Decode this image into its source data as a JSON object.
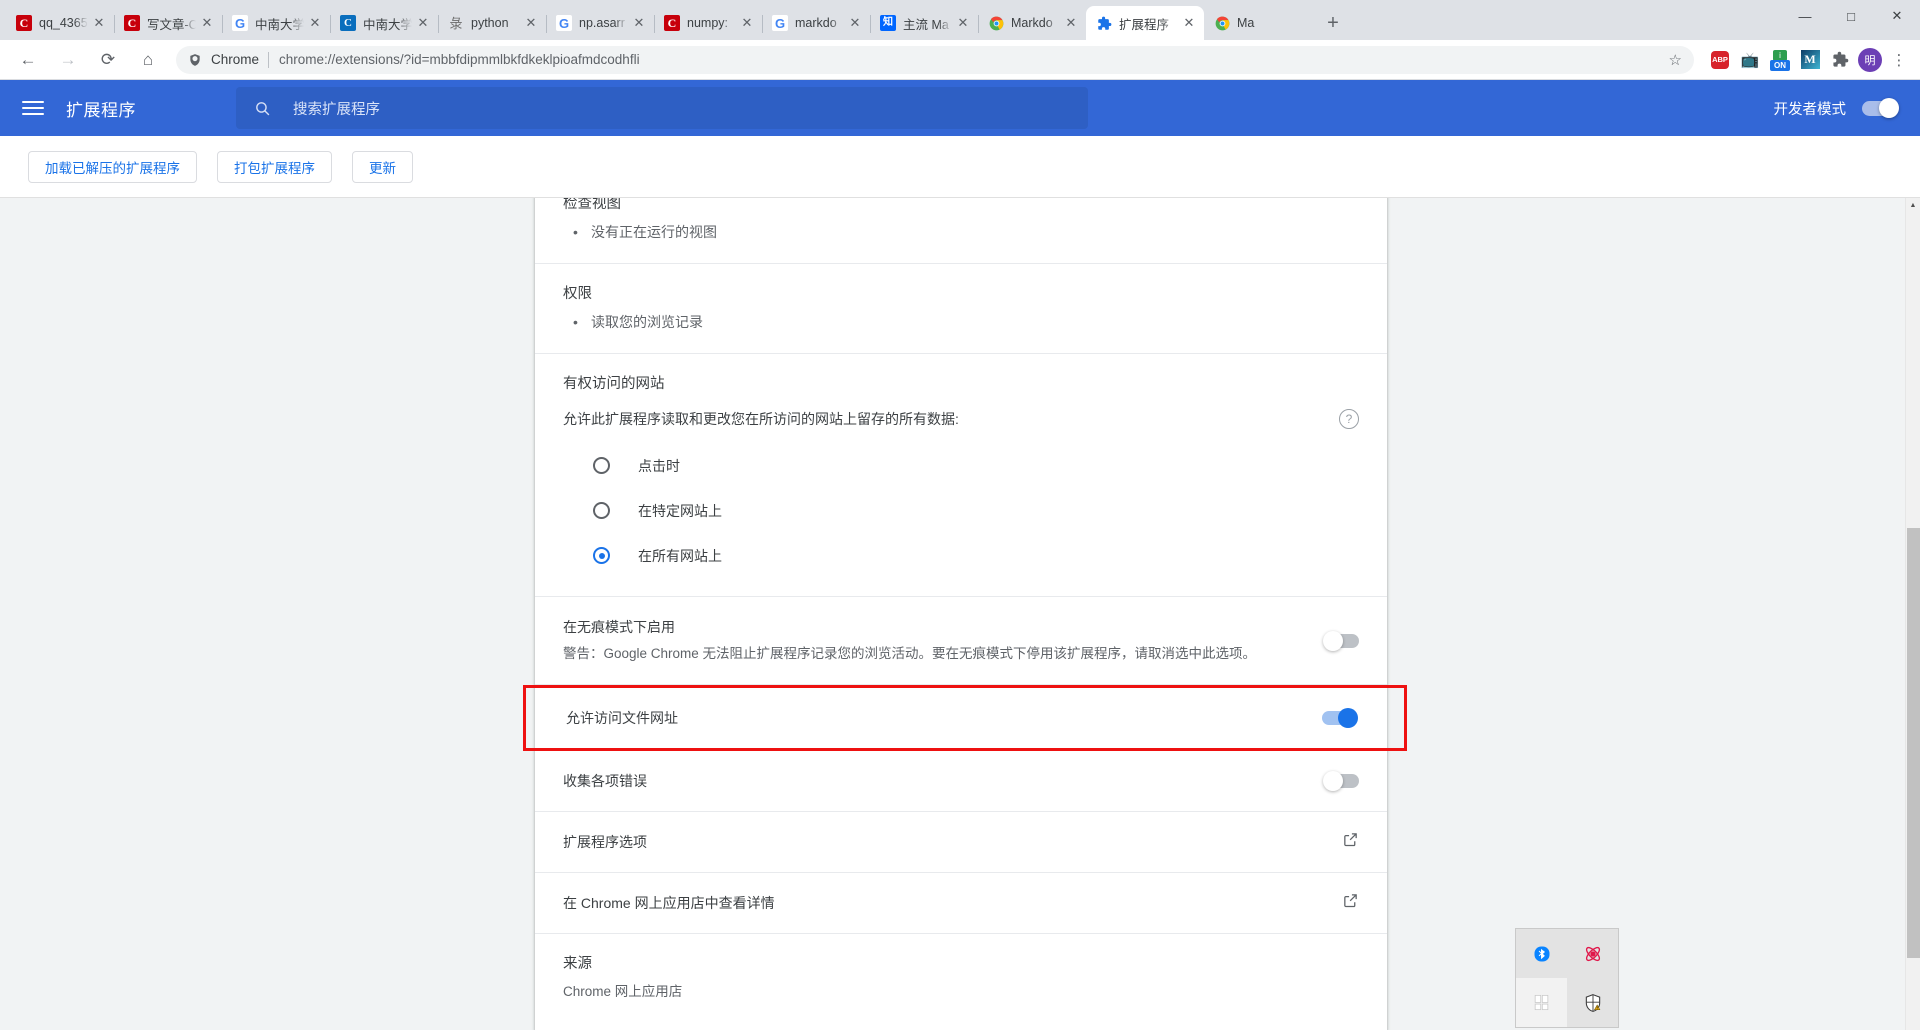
{
  "browser": {
    "tabs": [
      {
        "title": "qq_4365",
        "favicon": "csdn-icon",
        "active": false
      },
      {
        "title": "写文章-C",
        "favicon": "csdn-icon",
        "active": false
      },
      {
        "title": "中南大学",
        "favicon": "google-icon",
        "active": false
      },
      {
        "title": "中南大学",
        "favicon": "csu-icon",
        "active": false
      },
      {
        "title": "python",
        "favicon": "python-icon",
        "active": false
      },
      {
        "title": "np.asarr",
        "favicon": "google-icon",
        "active": false
      },
      {
        "title": "numpy:",
        "favicon": "csdn-icon",
        "active": false
      },
      {
        "title": "markdo",
        "favicon": "google-icon",
        "active": false
      },
      {
        "title": "主流 Ma",
        "favicon": "zhihu-icon",
        "active": false
      },
      {
        "title": "Markdo",
        "favicon": "chrome-icon",
        "active": false
      },
      {
        "title": "扩展程序",
        "favicon": "puzzle-icon",
        "active": true
      },
      {
        "title": "Ma",
        "favicon": "chrome-icon",
        "active": false
      }
    ],
    "new_tab_label": "+",
    "close_label": "✕",
    "window_controls": {
      "minimize": "—",
      "maximize": "□",
      "close": "✕"
    },
    "nav": {
      "back": "←",
      "forward": "→",
      "reload": "⟳",
      "home": "⌂"
    },
    "omnibox": {
      "chip": "Chrome",
      "url": "chrome://extensions/?id=mbbfdipmmlbkfdkeklpioafmdcodhfli",
      "star": "☆"
    },
    "toolbar_icons": [
      {
        "name": "adblock-plus-icon",
        "label": "ABP"
      },
      {
        "name": "tv-icon",
        "label": "📺"
      },
      {
        "name": "on-badge-icon",
        "label": "ON"
      },
      {
        "name": "markdown-m-icon",
        "label": "M"
      },
      {
        "name": "extensions-puzzle-icon",
        "label": "🧩"
      },
      {
        "name": "profile-avatar",
        "label": "明"
      },
      {
        "name": "chrome-menu-icon",
        "label": "⋮"
      }
    ]
  },
  "ext_header": {
    "title": "扩展程序",
    "search_placeholder": "搜索扩展程序",
    "dev_mode_label": "开发者模式",
    "dev_mode_on": true
  },
  "action_bar": {
    "load_unpacked": "加载已解压的扩展程序",
    "pack_extension": "打包扩展程序",
    "update": "更新"
  },
  "detail": {
    "inspect_views": {
      "title": "检查视图",
      "items": [
        "没有正在运行的视图"
      ]
    },
    "permissions": {
      "title": "权限",
      "items": [
        "读取您的浏览记录"
      ]
    },
    "site_access": {
      "title": "有权访问的网站",
      "description": "允许此扩展程序读取和更改您在所访问的网站上留存的所有数据:",
      "help_icon": "?",
      "options": [
        {
          "label": "点击时",
          "selected": false
        },
        {
          "label": "在特定网站上",
          "selected": false
        },
        {
          "label": "在所有网站上",
          "selected": true
        }
      ]
    },
    "incognito": {
      "title": "在无痕模式下启用",
      "warning": "警告：Google Chrome 无法阻止扩展程序记录您的浏览活动。要在无痕模式下停用该扩展程序，请取消选中此选项。",
      "enabled": false
    },
    "file_urls": {
      "title": "允许访问文件网址",
      "enabled": true,
      "highlighted": true
    },
    "collect_errors": {
      "title": "收集各项错误",
      "enabled": false
    },
    "extension_options": {
      "title": "扩展程序选项",
      "icon": "open-in-new-icon"
    },
    "webstore_details": {
      "title": "在 Chrome 网上应用店中查看详情",
      "icon": "open-in-new-icon"
    },
    "source": {
      "title": "来源",
      "value": "Chrome 网上应用店"
    }
  },
  "tray": {
    "items": [
      {
        "name": "bluetooth-icon",
        "glyph": "✶"
      },
      {
        "name": "red-atom-icon",
        "glyph": "✺"
      },
      {
        "name": "windows-flag-icon",
        "glyph": "❖"
      },
      {
        "name": "security-shield-warning-icon",
        "glyph": "⛉"
      }
    ]
  },
  "colors": {
    "header_blue": "#3367d6",
    "accent_blue": "#1a73e8",
    "highlight_red": "#ee1111"
  }
}
